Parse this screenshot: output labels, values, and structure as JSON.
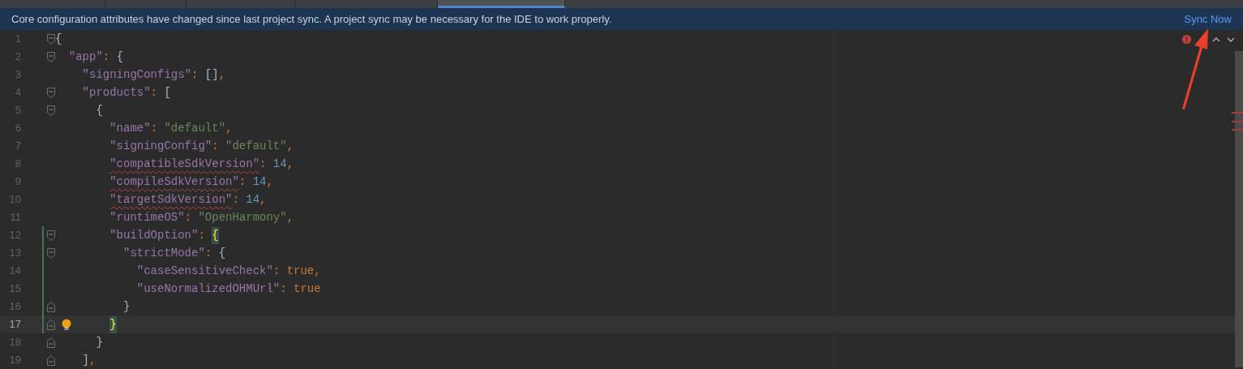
{
  "tabs": [
    {
      "selected": false
    },
    {
      "selected": false
    },
    {
      "selected": false
    },
    {
      "selected": false
    },
    {
      "selected": true
    }
  ],
  "banner": {
    "message": "Core configuration attributes have changed since last project sync. A project sync may be necessary for the IDE to work properly.",
    "action": "Sync Now"
  },
  "editor": {
    "lines": [
      {
        "n": "1",
        "kind": "fold-start",
        "current": false,
        "changed": false,
        "bulb": false,
        "warning": false,
        "tokens": [
          {
            "kind": "brace",
            "text": "{"
          }
        ]
      },
      {
        "n": "2",
        "kind": "fold-start",
        "current": false,
        "changed": false,
        "bulb": false,
        "warning": false,
        "tokens": [
          {
            "kind": "key",
            "text": "\"app\""
          },
          {
            "kind": "punct",
            "text": ": "
          },
          {
            "kind": "brace",
            "text": "{"
          }
        ]
      },
      {
        "n": "3",
        "kind": "plain",
        "current": false,
        "changed": false,
        "bulb": false,
        "warning": false,
        "tokens": [
          {
            "kind": "key",
            "text": "\"signingConfigs\""
          },
          {
            "kind": "punct",
            "text": ": "
          },
          {
            "kind": "brace",
            "text": "[]"
          },
          {
            "kind": "punct",
            "text": ","
          }
        ]
      },
      {
        "n": "4",
        "kind": "fold-start",
        "current": false,
        "changed": false,
        "bulb": false,
        "warning": false,
        "tokens": [
          {
            "kind": "key",
            "text": "\"products\""
          },
          {
            "kind": "punct",
            "text": ": "
          },
          {
            "kind": "brace",
            "text": "["
          }
        ]
      },
      {
        "n": "5",
        "kind": "fold-start",
        "current": false,
        "changed": false,
        "bulb": false,
        "warning": false,
        "tokens": [
          {
            "kind": "brace",
            "text": "{"
          }
        ]
      },
      {
        "n": "6",
        "kind": "plain",
        "current": false,
        "changed": false,
        "bulb": false,
        "warning": false,
        "tokens": [
          {
            "kind": "key",
            "text": "\"name\""
          },
          {
            "kind": "punct",
            "text": ": "
          },
          {
            "kind": "str",
            "text": "\"default\""
          },
          {
            "kind": "punct",
            "text": ","
          }
        ]
      },
      {
        "n": "7",
        "kind": "plain",
        "current": false,
        "changed": false,
        "bulb": false,
        "warning": false,
        "tokens": [
          {
            "kind": "key",
            "text": "\"signingConfig\""
          },
          {
            "kind": "punct",
            "text": ": "
          },
          {
            "kind": "str",
            "text": "\"default\""
          },
          {
            "kind": "punct",
            "text": ","
          }
        ]
      },
      {
        "n": "8",
        "kind": "plain",
        "current": false,
        "changed": false,
        "bulb": false,
        "warning": true,
        "tokens": [
          {
            "kind": "key",
            "text": "\"compatibleSdkVersion\""
          },
          {
            "kind": "punct",
            "text": ": "
          },
          {
            "kind": "num",
            "text": "14"
          },
          {
            "kind": "punct",
            "text": ","
          }
        ]
      },
      {
        "n": "9",
        "kind": "plain",
        "current": false,
        "changed": false,
        "bulb": false,
        "warning": true,
        "tokens": [
          {
            "kind": "key",
            "text": "\"compileSdkVersion\""
          },
          {
            "kind": "punct",
            "text": ": "
          },
          {
            "kind": "num",
            "text": "14"
          },
          {
            "kind": "punct",
            "text": ","
          }
        ]
      },
      {
        "n": "10",
        "kind": "plain",
        "current": false,
        "changed": false,
        "bulb": false,
        "warning": true,
        "tokens": [
          {
            "kind": "key",
            "text": "\"targetSdkVersion\""
          },
          {
            "kind": "punct",
            "text": ": "
          },
          {
            "kind": "num",
            "text": "14"
          },
          {
            "kind": "punct",
            "text": ","
          }
        ]
      },
      {
        "n": "11",
        "kind": "plain",
        "current": false,
        "changed": false,
        "bulb": false,
        "warning": false,
        "tokens": [
          {
            "kind": "key",
            "text": "\"runtimeOS\""
          },
          {
            "kind": "punct",
            "text": ": "
          },
          {
            "kind": "str",
            "text": "\"OpenHarmony\""
          },
          {
            "kind": "punct",
            "text": ","
          }
        ]
      },
      {
        "n": "12",
        "kind": "fold-start",
        "current": false,
        "changed": true,
        "bulb": false,
        "warning": false,
        "tokens": [
          {
            "kind": "key",
            "text": "\"buildOption\""
          },
          {
            "kind": "punct",
            "text": ": "
          },
          {
            "kind": "match",
            "text": "{"
          }
        ]
      },
      {
        "n": "13",
        "kind": "fold-start",
        "current": false,
        "changed": true,
        "bulb": false,
        "warning": false,
        "tokens": [
          {
            "kind": "key",
            "text": "\"strictMode\""
          },
          {
            "kind": "punct",
            "text": ": "
          },
          {
            "kind": "brace",
            "text": "{"
          }
        ]
      },
      {
        "n": "14",
        "kind": "plain",
        "current": false,
        "changed": true,
        "bulb": false,
        "warning": false,
        "tokens": [
          {
            "kind": "key",
            "text": "\"caseSensitiveCheck\""
          },
          {
            "kind": "punct",
            "text": ": "
          },
          {
            "kind": "kw",
            "text": "true"
          },
          {
            "kind": "punct",
            "text": ","
          }
        ]
      },
      {
        "n": "15",
        "kind": "plain",
        "current": false,
        "changed": true,
        "bulb": false,
        "warning": false,
        "tokens": [
          {
            "kind": "key",
            "text": "\"useNormalizedOHMUrl\""
          },
          {
            "kind": "punct",
            "text": ": "
          },
          {
            "kind": "kw",
            "text": "true"
          }
        ]
      },
      {
        "n": "16",
        "kind": "fold-end",
        "current": false,
        "changed": true,
        "bulb": false,
        "warning": false,
        "tokens": [
          {
            "kind": "brace",
            "text": "}"
          }
        ]
      },
      {
        "n": "17",
        "kind": "fold-end",
        "current": true,
        "changed": true,
        "bulb": true,
        "warning": false,
        "tokens": [
          {
            "kind": "match",
            "text": "}"
          }
        ]
      },
      {
        "n": "18",
        "kind": "fold-end",
        "current": false,
        "changed": false,
        "bulb": false,
        "warning": false,
        "tokens": [
          {
            "kind": "brace",
            "text": "}"
          }
        ]
      },
      {
        "n": "19",
        "kind": "fold-end",
        "current": false,
        "changed": false,
        "bulb": false,
        "warning": false,
        "tokens": [
          {
            "kind": "brace",
            "text": "]"
          },
          {
            "kind": "punct",
            "text": ","
          }
        ]
      }
    ]
  }
}
